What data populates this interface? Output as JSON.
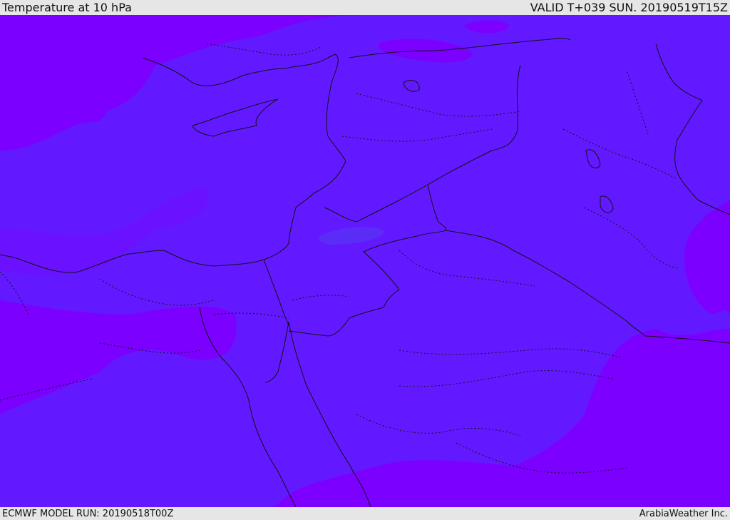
{
  "header": {
    "title": "Temperature at 10 hPa",
    "valid": "VALID T+039 SUN. 20190519T15Z"
  },
  "footer": {
    "model_run": "ECMWF MODEL RUN: 20190518T00Z",
    "provider": "ArabiaWeather Inc."
  },
  "colors": {
    "bar_bg": "#e6e6e6",
    "warm_violet": "#7b00ff",
    "cool_violet": "#6319ff",
    "light_blue_violet": "#5a2cf5",
    "border_line": "#111111"
  }
}
